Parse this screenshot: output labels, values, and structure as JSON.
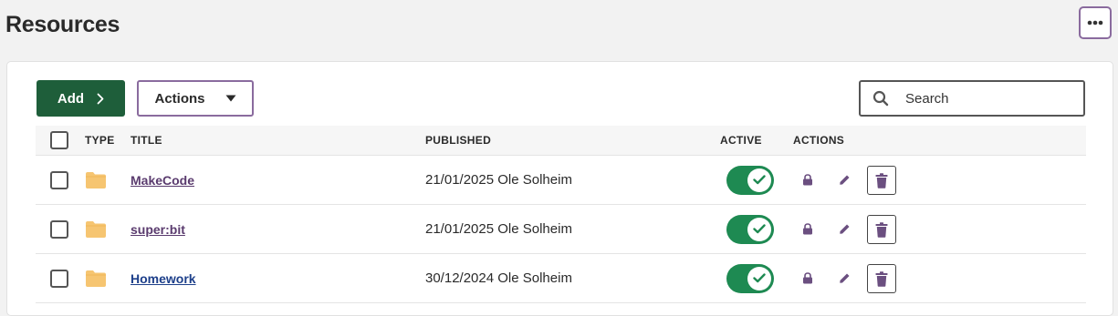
{
  "page": {
    "title": "Resources",
    "more_icon": "ellipsis-icon"
  },
  "toolbar": {
    "add_label": "Add",
    "actions_label": "Actions",
    "search_placeholder": "Search"
  },
  "table": {
    "columns": {
      "type": "TYPE",
      "title": "TITLE",
      "published": "PUBLISHED",
      "active": "ACTIVE",
      "actions": "ACTIONS"
    },
    "rows": [
      {
        "type_icon": "folder-icon",
        "title": "MakeCode",
        "published": "21/01/2025 Ole Solheim",
        "active": true
      },
      {
        "type_icon": "folder-icon",
        "title": "super:bit",
        "published": "21/01/2025 Ole Solheim",
        "active": true
      },
      {
        "type_icon": "folder-icon",
        "title": "Homework",
        "published": "30/12/2024 Ole Solheim",
        "active": true
      }
    ]
  },
  "colors": {
    "brand_green": "#1e5e3a",
    "toggle_green": "#1e8a52",
    "accent_purple": "#8a6b9e",
    "link_purple": "#5a3b6e",
    "link_blue": "#1d3f8a",
    "folder": "#f6c571"
  }
}
